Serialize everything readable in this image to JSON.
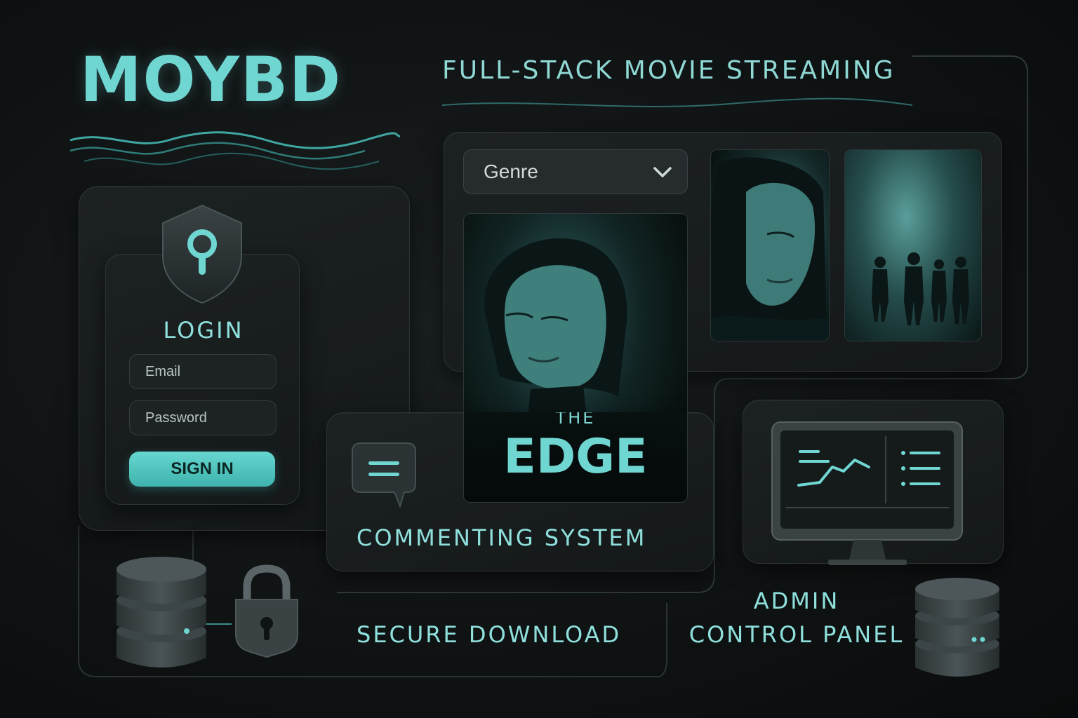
{
  "brand": {
    "name": "MOYBD"
  },
  "header": {
    "subtitle": "FULL-STACK MOVIE STREAMING"
  },
  "login": {
    "title": "LOGIN",
    "email_placeholder": "Email",
    "password_placeholder": "Password",
    "sign_in_label": "SIGN IN"
  },
  "browse": {
    "genre_select": {
      "value": "Genre"
    },
    "featured": {
      "pre_title": "THE",
      "title": "EDGE"
    }
  },
  "features": {
    "commenting": "COMMENTING SYSTEM",
    "secure_download": "SECURE DOWNLOAD",
    "admin_line1": "ADMIN",
    "admin_line2": "CONTROL PANEL"
  },
  "colors": {
    "accent": "#6fd6d2",
    "background": "#101314",
    "panel": "#1a1f20"
  }
}
